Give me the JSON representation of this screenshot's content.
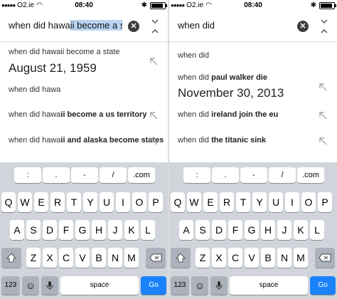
{
  "status": {
    "carrier": "O2.ie",
    "time": "08:40"
  },
  "left": {
    "query_plain": "when did hawa",
    "query_highlight": "ii become a s…",
    "suggestions": [
      {
        "prefix": "when did hawaii become a state",
        "bold": ""
      },
      {
        "prefix": "when did hawa",
        "bold": ""
      },
      {
        "prefix": "when did hawa",
        "bold": "ii become a us territory"
      },
      {
        "prefix": "when did hawa",
        "bold": "ii and alaska become states"
      }
    ],
    "answer": "August 21, 1959"
  },
  "right": {
    "query": "when did",
    "suggestions": [
      {
        "prefix": "when did",
        "bold": ""
      },
      {
        "prefix": "when did",
        "bold": " paul walker die"
      },
      {
        "prefix": "when did",
        "bold": " ireland join the eu"
      },
      {
        "prefix": "when did",
        "bold": " the titanic sink"
      }
    ],
    "answer": "November 30, 2013"
  },
  "keyboard": {
    "util_row": [
      ":",
      ".",
      "-",
      "/",
      ".com"
    ],
    "row1": [
      "Q",
      "W",
      "E",
      "R",
      "T",
      "Y",
      "U",
      "I",
      "O",
      "P"
    ],
    "row2": [
      "A",
      "S",
      "D",
      "F",
      "G",
      "H",
      "J",
      "K",
      "L"
    ],
    "row3": [
      "Z",
      "X",
      "C",
      "V",
      "B",
      "N",
      "M"
    ],
    "numbers_label": "123",
    "space_label": "space",
    "go_label": "Go",
    "icons": [
      "shift-icon",
      "backspace-icon",
      "emoji-icon",
      "microphone-icon"
    ]
  },
  "colors": {
    "go": "#1a82fb",
    "keyboard_bg": "#d1d5db",
    "highlight": "#b9d3f0"
  }
}
